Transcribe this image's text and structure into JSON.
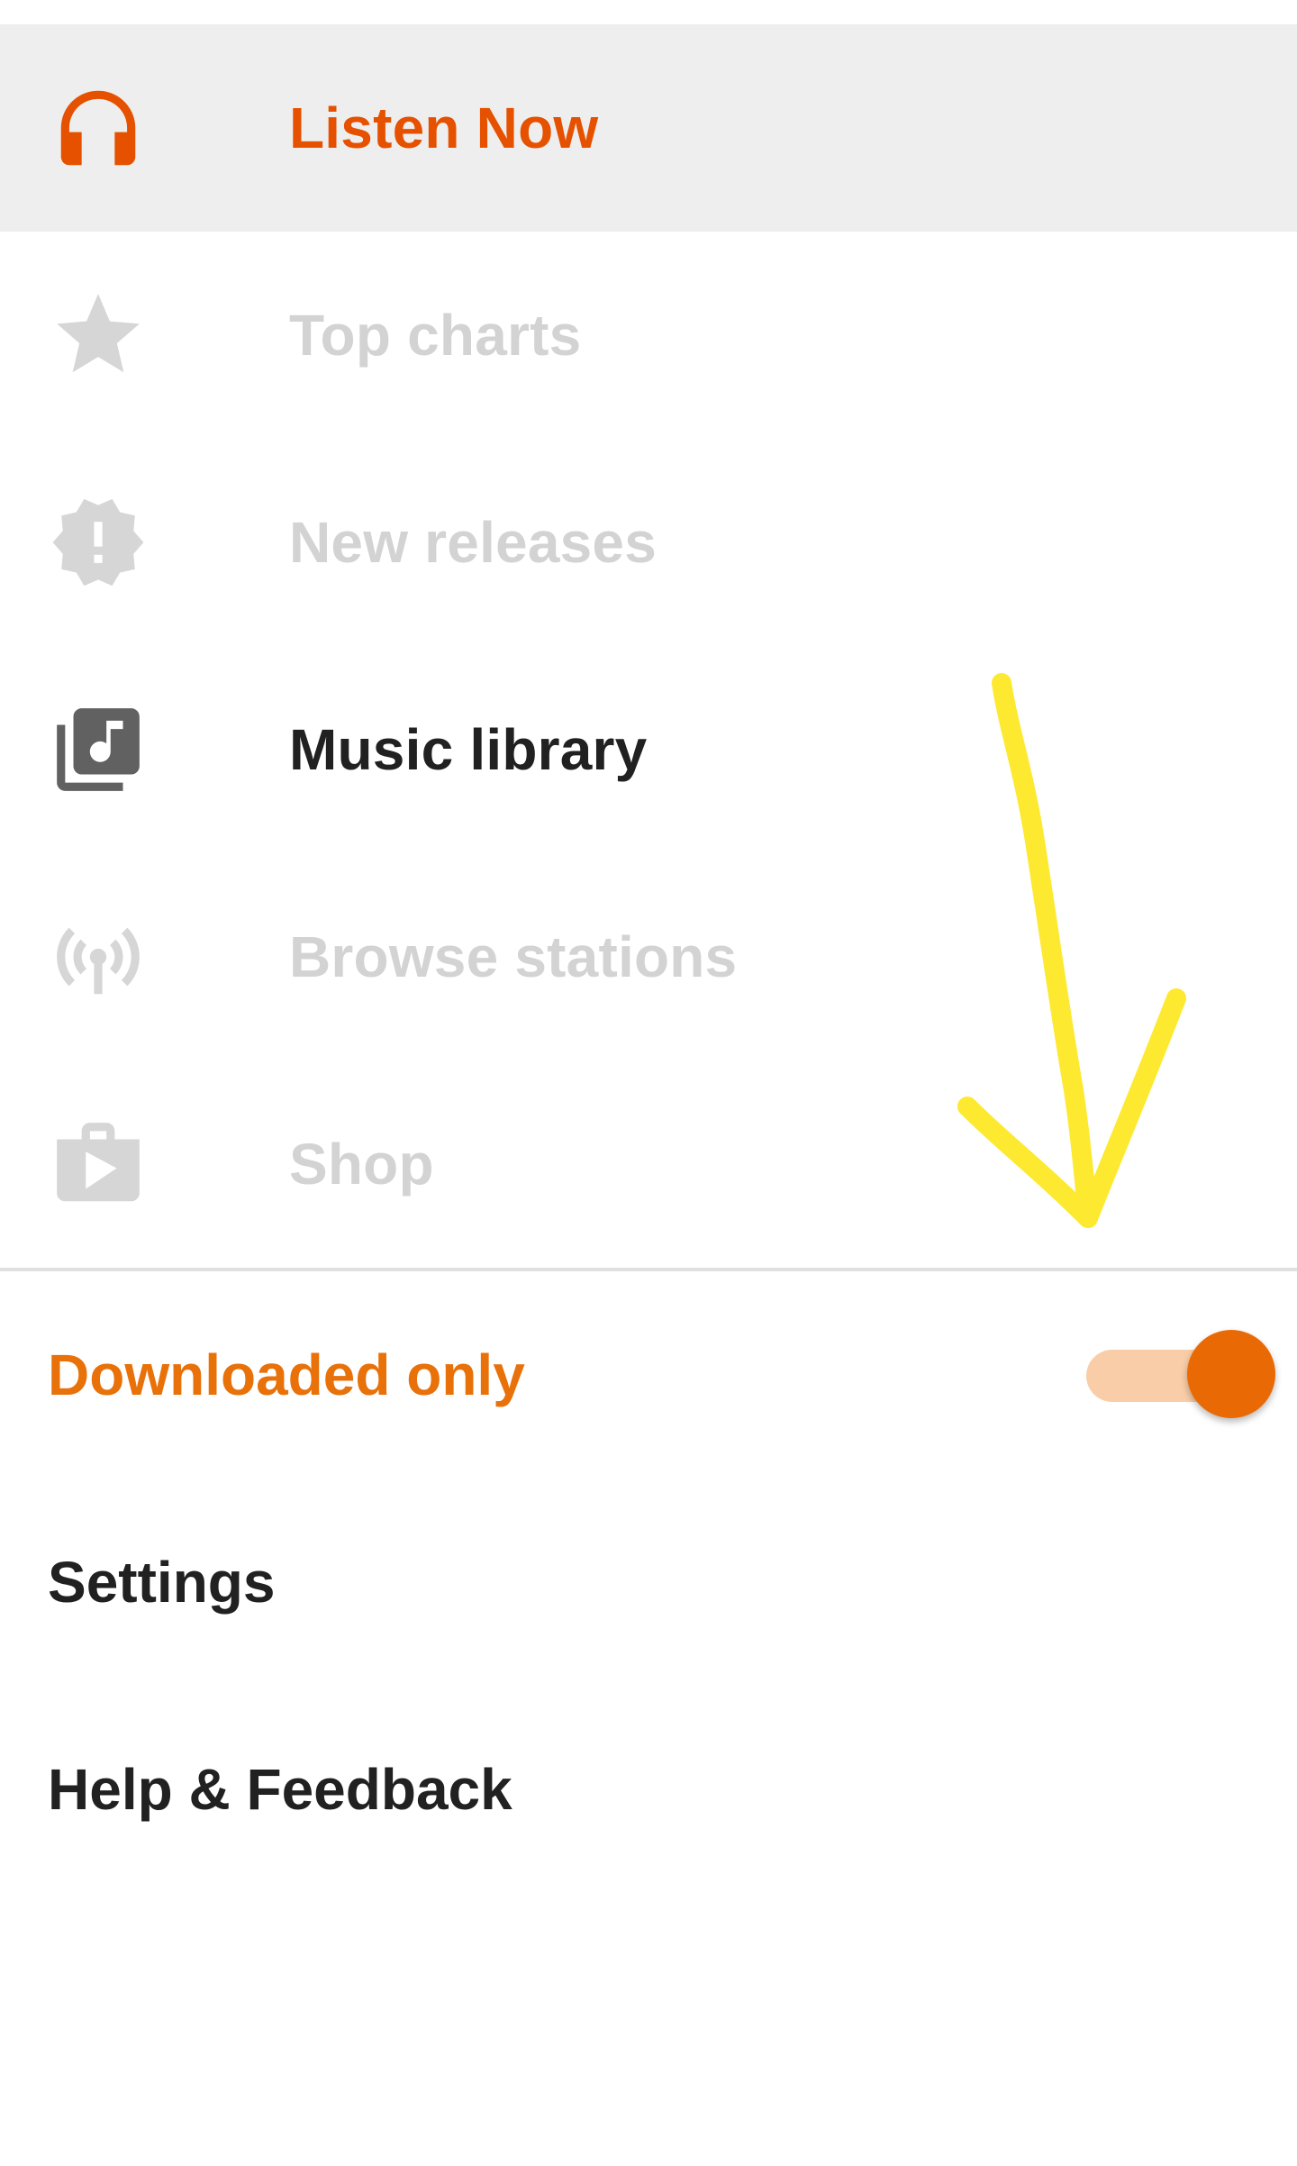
{
  "colors": {
    "accent": "#e65100",
    "accent_label": "#e8710a",
    "active_row_bg": "#eeeeee",
    "disabled_text": "#d3d3d3",
    "primary_text": "#212121",
    "annotation": "#fde92f"
  },
  "nav": {
    "items": [
      {
        "label": "Listen Now",
        "icon": "headphones-icon",
        "state": "active"
      },
      {
        "label": "Top charts",
        "icon": "star-icon",
        "state": "disabled"
      },
      {
        "label": "New releases",
        "icon": "alert-badge-icon",
        "state": "disabled"
      },
      {
        "label": "Music library",
        "icon": "music-library-icon",
        "state": "enabled"
      },
      {
        "label": "Browse stations",
        "icon": "radio-tower-icon",
        "state": "disabled"
      },
      {
        "label": "Shop",
        "icon": "shopping-bag-play-icon",
        "state": "disabled"
      }
    ]
  },
  "settings": {
    "downloaded_only": {
      "label": "Downloaded only",
      "enabled": true
    },
    "settings_label": "Settings",
    "help_label": "Help & Feedback"
  },
  "annotation": {
    "type": "hand-drawn-arrow",
    "direction": "down"
  }
}
